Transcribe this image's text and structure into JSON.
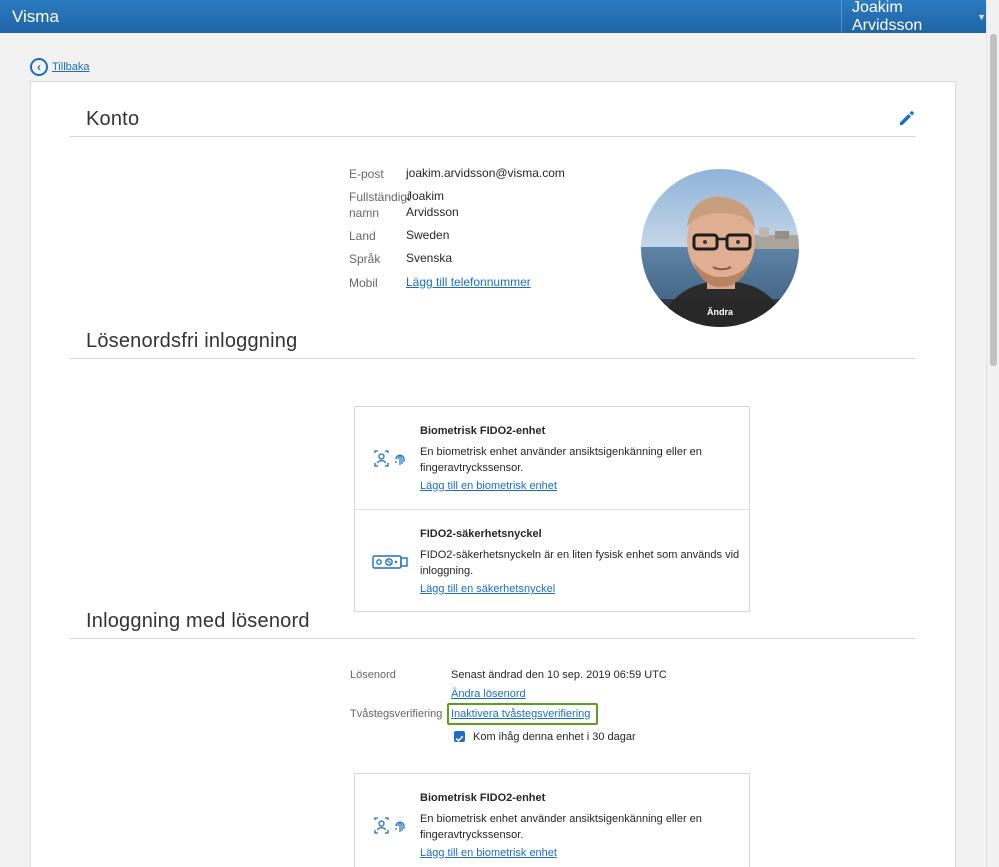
{
  "header": {
    "brand": "Visma",
    "user_name": "Joakim Arvidsson"
  },
  "nav": {
    "back_label": "Tillbaka"
  },
  "account": {
    "title": "Konto",
    "email_label": "E-post",
    "email_value": "joakim.arvidsson@visma.com",
    "fullname_label_line1": "Fullständigt",
    "fullname_label_line2": "namn",
    "fullname_value_line1": "Joakim",
    "fullname_value_line2": "Arvidsson",
    "country_label": "Land",
    "country_value": "Sweden",
    "language_label": "Språk",
    "language_value": "Svenska",
    "mobile_label": "Mobil",
    "mobile_link": "Lägg till telefonnummer",
    "avatar_change": "Ändra"
  },
  "passwordless": {
    "title": "Lösenordsfri inloggning",
    "items": [
      {
        "title": "Biometrisk FIDO2-enhet",
        "desc": "En biometrisk enhet använder ansiktsigenkänning eller en fingeravtryckssensor.",
        "link": "Lägg till en biometrisk enhet"
      },
      {
        "title": "FIDO2-säkerhetsnyckel",
        "desc": "FIDO2-säkerhetsnyckeln är en liten fysisk enhet som används vid inloggning.",
        "link": "Lägg till en säkerhetsnyckel"
      }
    ]
  },
  "password_login": {
    "title": "Inloggning med lösenord",
    "password_label": "Lösenord",
    "password_status": "Senast ändrad den 10 sep. 2019 06:59 UTC",
    "change_password_link": "Ändra lösenord",
    "twostep_label": "Tvåstegsverifiering",
    "twostep_link": "Inaktivera tvåstegsverifiering",
    "remember_label": "Kom ihåg denna enhet i 30 dagar",
    "remember_checked": true,
    "items": [
      {
        "title": "Biometrisk FIDO2-enhet",
        "desc": "En biometrisk enhet använder ansiktsigenkänning eller en fingeravtryckssensor.",
        "link": "Lägg till en biometrisk enhet"
      }
    ]
  },
  "colors": {
    "header": "#2270b3",
    "link": "#1b6ec2",
    "highlight": "#5e9e1c"
  },
  "icons": [
    "chevron-down-icon",
    "back-arrow-icon",
    "pencil-icon",
    "face-fingerprint-icon",
    "security-key-icon",
    "checkmark-icon"
  ]
}
